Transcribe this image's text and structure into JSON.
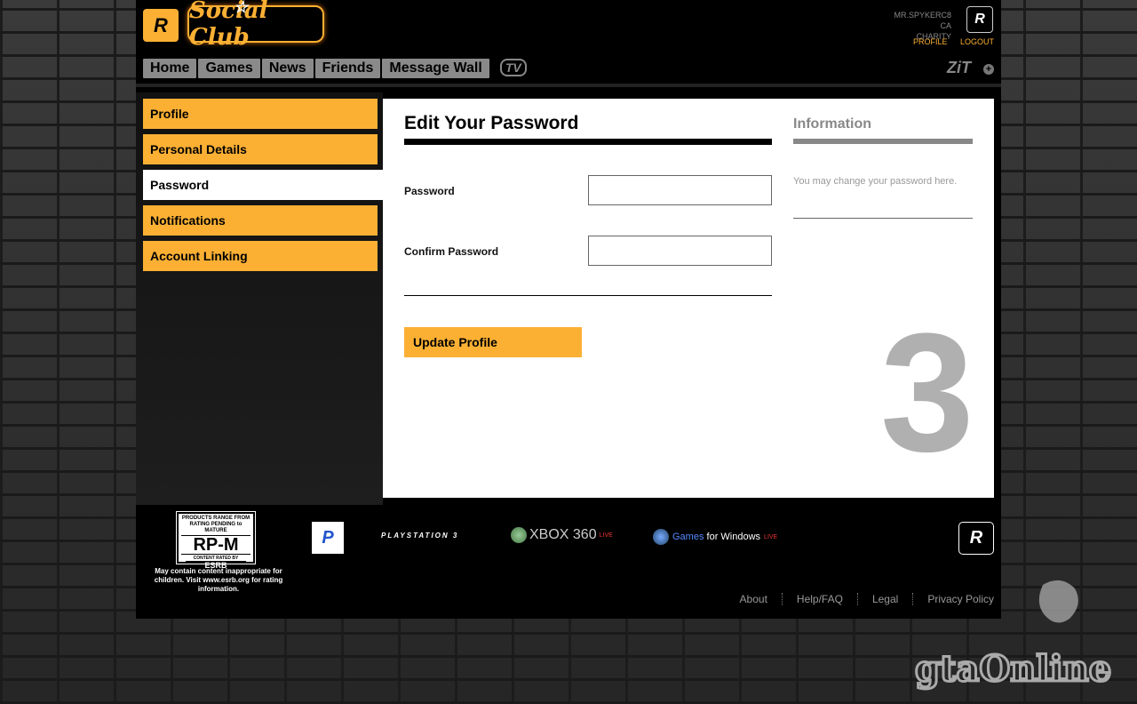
{
  "header": {
    "logo_letter": "R",
    "brand": "Social Club",
    "user": {
      "name": "MR.SPYKERC8",
      "region": "CA",
      "charity": "CHARITY"
    },
    "user_logo": "R",
    "links": {
      "profile": "PROFILE",
      "logout": "LOGOUT"
    }
  },
  "nav": {
    "items": [
      "Home",
      "Games",
      "News",
      "Friends",
      "Message Wall"
    ],
    "tv": "TV",
    "zit": "ZiT",
    "plus": "+"
  },
  "sidebar": {
    "items": [
      {
        "label": "Profile",
        "active": false
      },
      {
        "label": "Personal Details",
        "active": false
      },
      {
        "label": "Password",
        "active": true
      },
      {
        "label": "Notifications",
        "active": false
      },
      {
        "label": "Account Linking",
        "active": false
      }
    ]
  },
  "form": {
    "title": "Edit Your Password",
    "password_label": "Password",
    "password_value": "",
    "confirm_label": "Confirm Password",
    "confirm_value": "",
    "submit_label": "Update Profile"
  },
  "info": {
    "title": "Information",
    "text": "You may change your password here.",
    "big_number": "3"
  },
  "footer": {
    "esrb": {
      "top": "PRODUCTS RANGE FROM RATING PENDING to MATURE",
      "rating": "RP-M",
      "bottom": "CONTENT RATED BY",
      "brand": "ESRB",
      "note": "May contain content inappropriate for children. Visit www.esrb.org for rating information."
    },
    "platforms": {
      "ps_symbol": "P",
      "ps3": "PLAYSTATION 3",
      "xbox": "XBOX 360",
      "live": "LIVE",
      "gfw_games": "Games",
      "gfw_rest": " for Windows"
    },
    "rockstar": "R",
    "links": [
      "About",
      "Help/FAQ",
      "Legal",
      "Privacy Policy"
    ]
  },
  "watermark": "gtaOnline",
  "colors": {
    "accent": "#fbb034",
    "bg": "#000000"
  }
}
